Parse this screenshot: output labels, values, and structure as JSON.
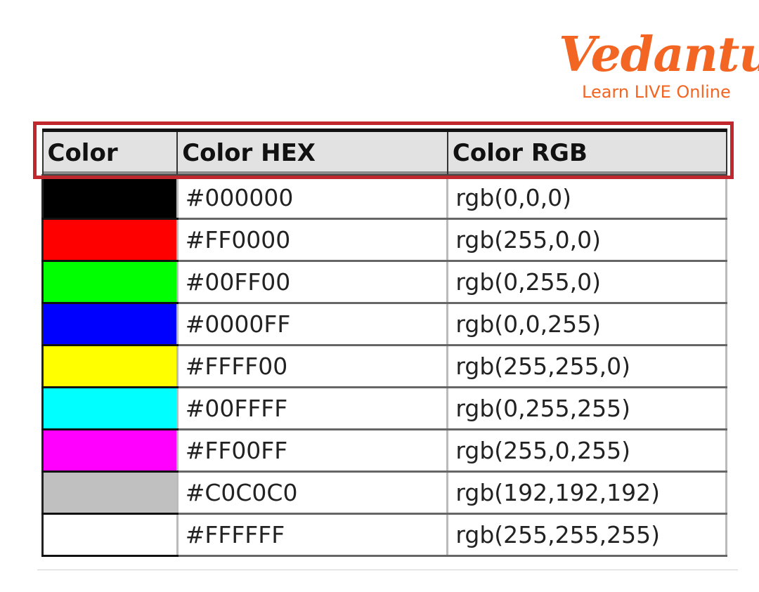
{
  "brand": {
    "name": "Vedantu",
    "tagline": "Learn LIVE Online",
    "color": "#f26522"
  },
  "table": {
    "headers": [
      "Color",
      "Color HEX",
      "Color RGB"
    ],
    "highlight_color": "#c0282d",
    "rows": [
      {
        "swatch": "#000000",
        "hex": "#000000",
        "rgb": "rgb(0,0,0)"
      },
      {
        "swatch": "#FF0000",
        "hex": "#FF0000",
        "rgb": "rgb(255,0,0)"
      },
      {
        "swatch": "#00FF00",
        "hex": "#00FF00",
        "rgb": "rgb(0,255,0)"
      },
      {
        "swatch": "#0000FF",
        "hex": "#0000FF",
        "rgb": "rgb(0,0,255)"
      },
      {
        "swatch": "#FFFF00",
        "hex": "#FFFF00",
        "rgb": "rgb(255,255,0)"
      },
      {
        "swatch": "#00FFFF",
        "hex": "#00FFFF",
        "rgb": "rgb(0,255,255)"
      },
      {
        "swatch": "#FF00FF",
        "hex": "#FF00FF",
        "rgb": "rgb(255,0,255)"
      },
      {
        "swatch": "#C0C0C0",
        "hex": "#C0C0C0",
        "rgb": "rgb(192,192,192)"
      },
      {
        "swatch": "#FFFFFF",
        "hex": "#FFFFFF",
        "rgb": "rgb(255,255,255)"
      }
    ]
  }
}
